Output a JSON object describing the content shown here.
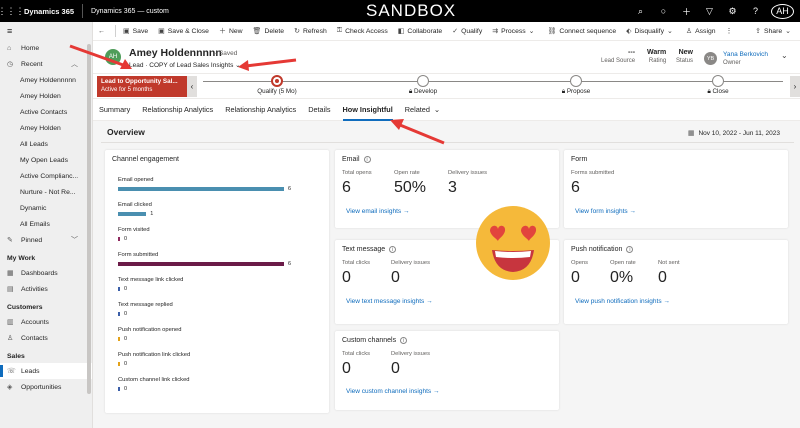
{
  "topbar": {
    "app_name": "Dynamics 365",
    "env_name": "Dynamics 365 — custom",
    "sandbox_label": "SANDBOX",
    "user_initials": "AH"
  },
  "sitemap": {
    "items": [
      {
        "label": "Home",
        "icon": "home-icon"
      },
      {
        "label": "Recent",
        "icon": "clock-icon"
      }
    ],
    "recent": [
      "Amey Holdennnnn",
      "Amey Holden",
      "Active Contacts",
      "Amey Holden",
      "All Leads",
      "My Open Leads",
      "Active Complianc...",
      "Nurture - Not Re...",
      "Dynamic",
      "All Emails"
    ],
    "pinned_label": "Pinned",
    "my_work_label": "My Work",
    "my_work": [
      "Dashboards",
      "Activities"
    ],
    "customers_label": "Customers",
    "customers": [
      "Accounts",
      "Contacts"
    ],
    "sales_label": "Sales",
    "sales": [
      "Leads",
      "Opportunities"
    ]
  },
  "cmdbar": {
    "commands": [
      "Save",
      "Save & Close",
      "New",
      "Delete",
      "Refresh",
      "Check Access",
      "Collaborate",
      "Qualify",
      "Process",
      "Connect sequence",
      "Disqualify",
      "Assign"
    ],
    "more": "⋮",
    "share": "Share"
  },
  "header": {
    "initials": "AH",
    "name": "Amey Holdennnnn",
    "saved": "- Saved",
    "entity": "Lead",
    "form": "COPY of Lead Sales Insights",
    "lead_source_value": "---",
    "lead_source_label": "Lead Source",
    "rating_value": "Warm",
    "rating_label": "Rating",
    "status_value": "New",
    "status_label": "Status",
    "owner_initials": "YB",
    "owner_value": "Yana Berkovich",
    "owner_label": "Owner"
  },
  "bpf": {
    "flag_title": "Lead to Opportunity Sal...",
    "flag_sub": "Active for 5 months",
    "stages": [
      "Qualify (5 Mo)",
      "Develop",
      "Propose",
      "Close"
    ]
  },
  "tabs": [
    "Summary",
    "Relationship Analytics",
    "Relationship Analytics",
    "Details",
    "How Insightful",
    "Related"
  ],
  "overview": {
    "title": "Overview",
    "date_range": "Nov 10, 2022 - Jun 11, 2023"
  },
  "channel_engagement": {
    "title": "Channel engagement",
    "rows": [
      {
        "label": "Email opened",
        "value": "6",
        "color": "#4a8fb0",
        "fraction": 1.0
      },
      {
        "label": "Email clicked",
        "value": "1",
        "color": "#4a8fb0",
        "fraction": 0.17
      },
      {
        "label": "Form visited",
        "value": "0",
        "color": "#8e2a5e",
        "fraction": 0
      },
      {
        "label": "Form submitted",
        "value": "6",
        "color": "#6b1b48",
        "fraction": 1.0
      },
      {
        "label": "Text message link clicked",
        "value": "0",
        "color": "#3b5ea8",
        "fraction": 0
      },
      {
        "label": "Text message replied",
        "value": "0",
        "color": "#3b5ea8",
        "fraction": 0
      },
      {
        "label": "Push notification opened",
        "value": "0",
        "color": "#e3a21a",
        "fraction": 0
      },
      {
        "label": "Push notification link clicked",
        "value": "0",
        "color": "#e3a21a",
        "fraction": 0
      },
      {
        "label": "Custom channel link clicked",
        "value": "0",
        "color": "#3b5ea8",
        "fraction": 0
      }
    ]
  },
  "email": {
    "title": "Email",
    "metrics": [
      {
        "label": "Total opens",
        "value": "6"
      },
      {
        "label": "Open rate",
        "value": "50%"
      },
      {
        "label": "Delivery issues",
        "value": "3"
      }
    ],
    "link": "View email insights →"
  },
  "form": {
    "title": "Form",
    "metrics": [
      {
        "label": "Forms submitted",
        "value": "6"
      }
    ],
    "link": "View form insights →"
  },
  "text_message": {
    "title": "Text message",
    "metrics": [
      {
        "label": "Total clicks",
        "value": "0"
      },
      {
        "label": "Delivery issues",
        "value": "0"
      }
    ],
    "link": "View text message insights →"
  },
  "push": {
    "title": "Push notification",
    "metrics": [
      {
        "label": "Opens",
        "value": "0"
      },
      {
        "label": "Open rate",
        "value": "0%"
      },
      {
        "label": "Not sent",
        "value": "0"
      }
    ],
    "link": "View push notification insights →"
  },
  "custom": {
    "title": "Custom channels",
    "metrics": [
      {
        "label": "Total clicks",
        "value": "0"
      },
      {
        "label": "Delivery issues",
        "value": "0"
      }
    ],
    "link": "View custom channel insights →"
  },
  "colors": {
    "accent": "#0f6cbd",
    "flag": "#c0392b",
    "arrow": "#e53935",
    "emoji": "#f5b93a"
  }
}
